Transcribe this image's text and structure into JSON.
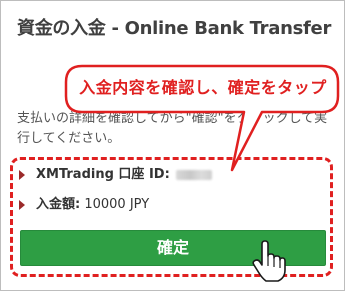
{
  "dialog": {
    "title": "資金の入金 - Online Bank Transfer",
    "description": "支払いの詳細を確認してから\"確認\"をクリックして実行してください。",
    "account_label": "XMTrading 口座 ID:",
    "amount_label": "入金額:",
    "amount_value": "10000 JPY",
    "confirm_button": "確定"
  },
  "annotation": {
    "callout_text": "入金内容を確認し、確定をタップ",
    "accent_color": "#e02020"
  },
  "colors": {
    "button_bg": "#2e9e44",
    "title_text": "#404040"
  }
}
